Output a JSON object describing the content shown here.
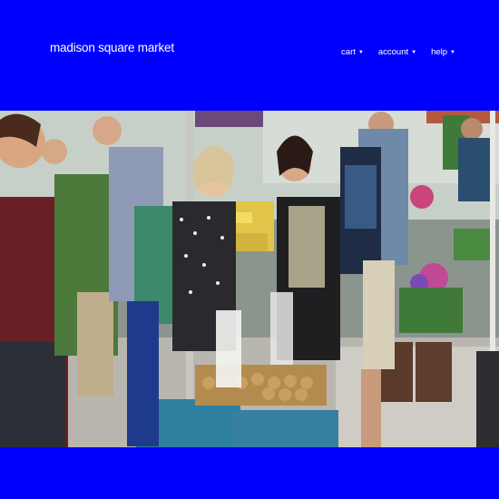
{
  "header": {
    "brand": "madison square market",
    "nav": [
      {
        "label": "cart",
        "icon": "chevron-down-icon"
      },
      {
        "label": "account",
        "icon": "chevron-down-icon"
      },
      {
        "label": "help",
        "icon": "chevron-down-icon"
      }
    ]
  },
  "colors": {
    "header_bg": "#0000ff",
    "footer_bg": "#0000ff",
    "text": "#ffffff"
  },
  "hero": {
    "description_icon": "market-photo"
  }
}
